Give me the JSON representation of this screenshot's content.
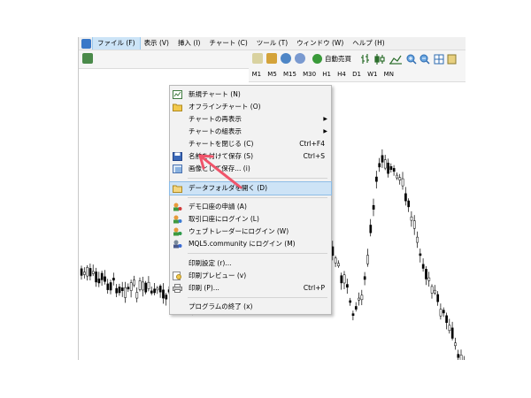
{
  "menubar": {
    "items": [
      {
        "label": "ファイル (F)",
        "active": true
      },
      {
        "label": "表示 (V)"
      },
      {
        "label": "挿入 (I)"
      },
      {
        "label": "チャート (C)"
      },
      {
        "label": "ツール (T)"
      },
      {
        "label": "ウィンドウ (W)"
      },
      {
        "label": "ヘルプ (H)"
      }
    ]
  },
  "toolbar": {
    "autotrade_label": "自動売買"
  },
  "timeframes": [
    "M1",
    "M5",
    "M15",
    "M30",
    "H1",
    "H4",
    "D1",
    "W1",
    "MN"
  ],
  "file_menu": {
    "items": [
      {
        "label": "新規チャート (N)",
        "icon": "new-chart-icon"
      },
      {
        "label": "オフラインチャート (O)",
        "icon": "folder-icon"
      },
      {
        "label": "チャートの再表示",
        "submenu": true
      },
      {
        "label": "チャートの組表示",
        "submenu": true
      },
      {
        "label": "チャートを閉じる (C)",
        "shortcut": "Ctrl+F4"
      },
      {
        "label": "名前を付けて保存 (S)",
        "shortcut": "Ctrl+S",
        "icon": "save-icon"
      },
      {
        "label": "画像として保存... (i)",
        "icon": "image-save-icon"
      },
      {
        "label": "データフォルダを開く (D)",
        "icon": "folder-open-icon",
        "highlighted": true
      },
      {
        "label": "デモ口座の申請 (A)",
        "icon": "demo-account-icon"
      },
      {
        "label": "取引口座にログイン (L)",
        "icon": "login-icon"
      },
      {
        "label": "ウェブトレーダーにログイン (W)",
        "icon": "webtrader-icon"
      },
      {
        "label": "MQL5.community にログイン (M)",
        "icon": "mql5-icon"
      },
      {
        "label": "印刷設定 (r)..."
      },
      {
        "label": "印刷プレビュー (v)",
        "icon": "print-preview-icon"
      },
      {
        "label": "印刷 (P)...",
        "shortcut": "Ctrl+P",
        "icon": "print-icon"
      },
      {
        "label": "プログラムの終了 (x)"
      }
    ]
  },
  "colors": {
    "arrow": "#f0546a",
    "candle_up": "#ffffff",
    "candle_down": "#000000",
    "highlight": "#cde3f6"
  }
}
